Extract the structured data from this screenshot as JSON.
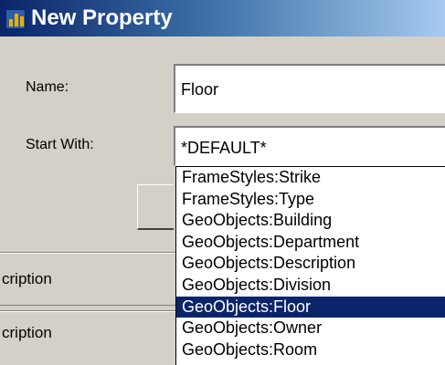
{
  "window": {
    "title": "New Property"
  },
  "form": {
    "name_label": "Name:",
    "name_value": "Floor",
    "start_label": "Start With:",
    "start_value": "*DEFAULT*"
  },
  "background_panel": {
    "header_label": "cription",
    "row_label": "cription"
  },
  "dropdown": {
    "options": [
      "FrameStyles:Strike",
      "FrameStyles:Type",
      "GeoObjects:Building",
      "GeoObjects:Department",
      "GeoObjects:Description",
      "GeoObjects:Division",
      "GeoObjects:Floor",
      "GeoObjects:Owner",
      "GeoObjects:Room"
    ],
    "selected_index": 6
  }
}
